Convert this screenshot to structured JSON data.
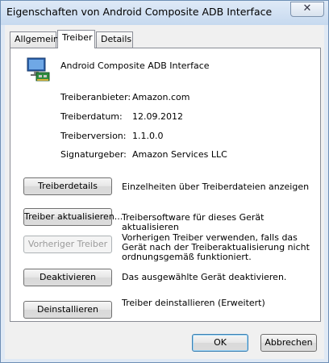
{
  "window": {
    "title": "Eigenschaften von Android Composite ADB Interface",
    "close_glyph": "✕"
  },
  "tabs": [
    {
      "label": "Allgemein",
      "active": false
    },
    {
      "label": "Treiber",
      "active": true
    },
    {
      "label": "Details",
      "active": false
    }
  ],
  "device": {
    "name": "Android Composite ADB Interface",
    "icon": "network-adapter-icon"
  },
  "properties": [
    {
      "label": "Treiberanbieter:",
      "value": "Amazon.com"
    },
    {
      "label": "Treiberdatum:",
      "value": "12.09.2012"
    },
    {
      "label": "Treiberversion:",
      "value": "1.1.0.0"
    },
    {
      "label": "Signaturgeber:",
      "value": "Amazon Services LLC"
    }
  ],
  "actions": [
    {
      "label": "Treiberdetails",
      "description": "Einzelheiten über Treiberdateien anzeigen",
      "enabled": true
    },
    {
      "label": "Treiber aktualisieren...",
      "description": "Treibersoftware für dieses Gerät aktualisieren",
      "enabled": true
    },
    {
      "label": "Vorheriger Treiber",
      "description": "Vorherigen Treiber verwenden, falls das Gerät nach der Treiberaktualisierung nicht ordnungsgemäß funktioniert.",
      "enabled": false
    },
    {
      "label": "Deaktivieren",
      "description": "Das ausgewählte Gerät deaktivieren.",
      "enabled": true
    },
    {
      "label": "Deinstallieren",
      "description": "Treiber deinstallieren (Erweitert)",
      "enabled": true
    }
  ],
  "dialog_buttons": {
    "ok": "OK",
    "cancel": "Abbrechen"
  },
  "colors": {
    "window_frame": "#dfe9f5",
    "panel": "#ffffff",
    "disabled_text": "#9a9a9a"
  }
}
